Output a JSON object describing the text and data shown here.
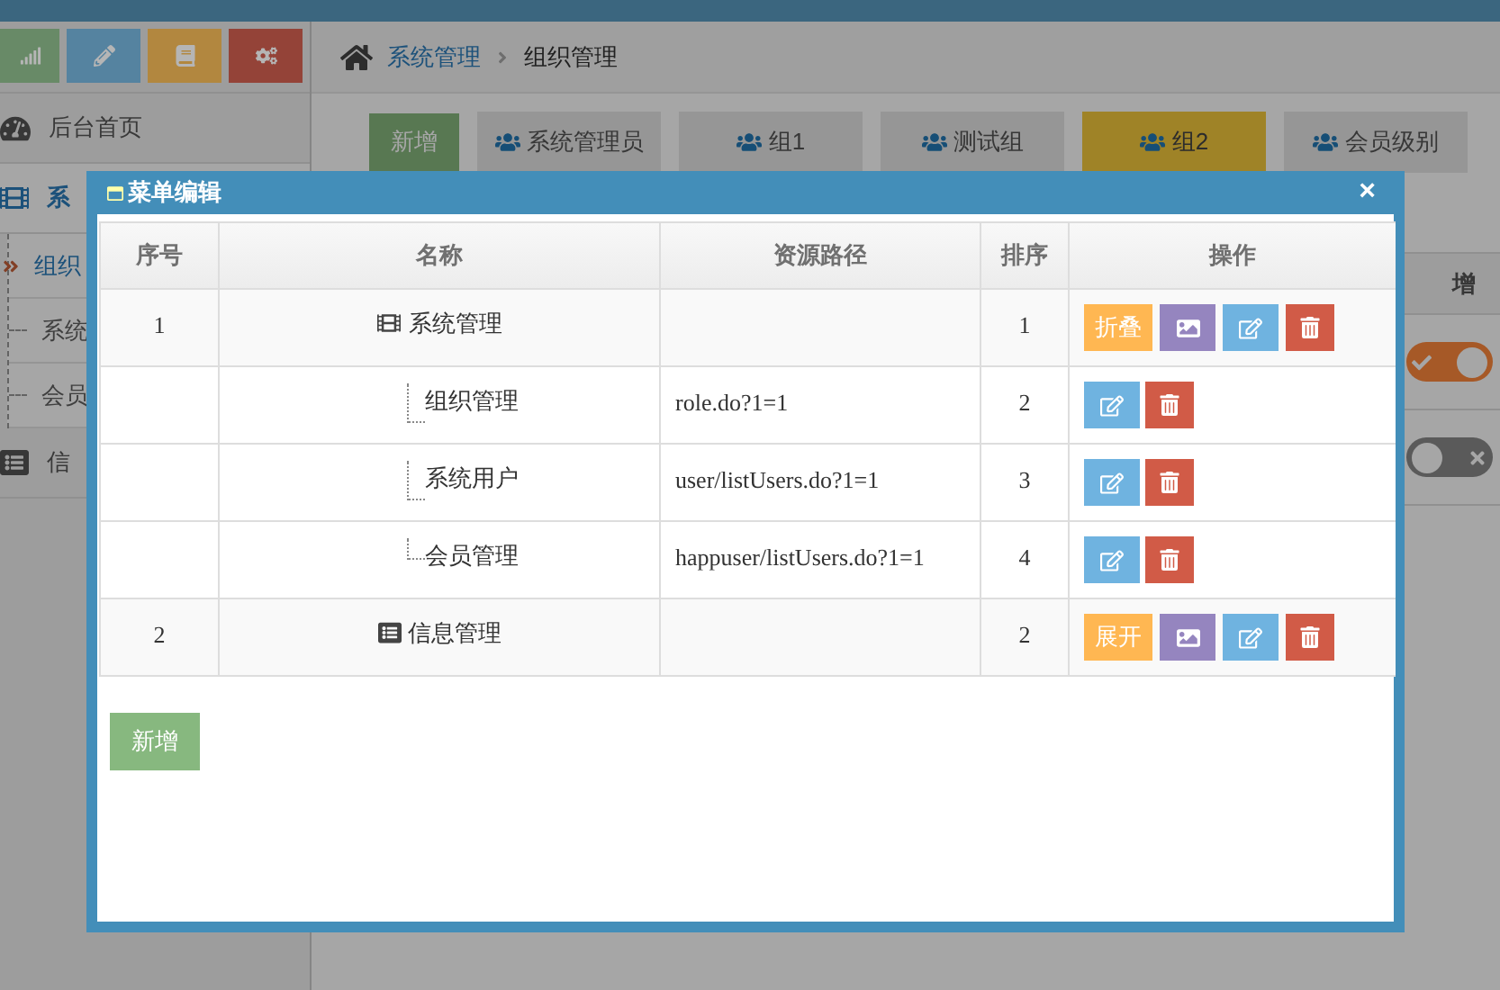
{
  "sidebar": {
    "shortcuts": [
      {
        "color": "#688a67"
      },
      {
        "color": "#5583a0"
      },
      {
        "color": "#b2873f"
      },
      {
        "color": "#944338"
      }
    ],
    "items": [
      {
        "label": "后台首页",
        "selected": false
      },
      {
        "label": "系",
        "selected": true,
        "expanded": true,
        "children": [
          {
            "label": "组织",
            "selected": true
          },
          {
            "label": "系统",
            "selected": false
          },
          {
            "label": "会员",
            "selected": false
          }
        ]
      },
      {
        "label": "信",
        "selected": false
      }
    ]
  },
  "breadcrumb": [
    {
      "label": "系统管理"
    },
    {
      "label": "组织管理"
    }
  ],
  "toolbar": {
    "add_button": "新增",
    "tabs": [
      {
        "label": "系统管理员",
        "selected": false
      },
      {
        "label": "组1",
        "selected": false
      },
      {
        "label": "测试组",
        "selected": false
      },
      {
        "label": "组2",
        "selected": true
      },
      {
        "label": "会员级别",
        "selected": false
      }
    ]
  },
  "background_table": {
    "column_header": "增",
    "rows": [
      {
        "on": true
      },
      {
        "on": false
      }
    ]
  },
  "dialog": {
    "title": "菜单编辑",
    "close": "×",
    "columns": [
      "序号",
      "名称",
      "资源路径",
      "排序",
      "操作"
    ],
    "rows": [
      {
        "number": "1",
        "name": "系统管理",
        "order": "1",
        "toggle": "折叠",
        "children": [
          {
            "name": "组织管理",
            "path": "role.do?1=1",
            "order": "2"
          },
          {
            "name": "系统用户",
            "path": "user/listUsers.do?1=1",
            "order": "3"
          },
          {
            "name": "会员管理",
            "path": "happuser/listUsers.do?1=1",
            "order": "4"
          }
        ]
      },
      {
        "number": "2",
        "name": "信息管理",
        "order": "2",
        "toggle": "展开"
      }
    ],
    "add_button": "新增"
  }
}
